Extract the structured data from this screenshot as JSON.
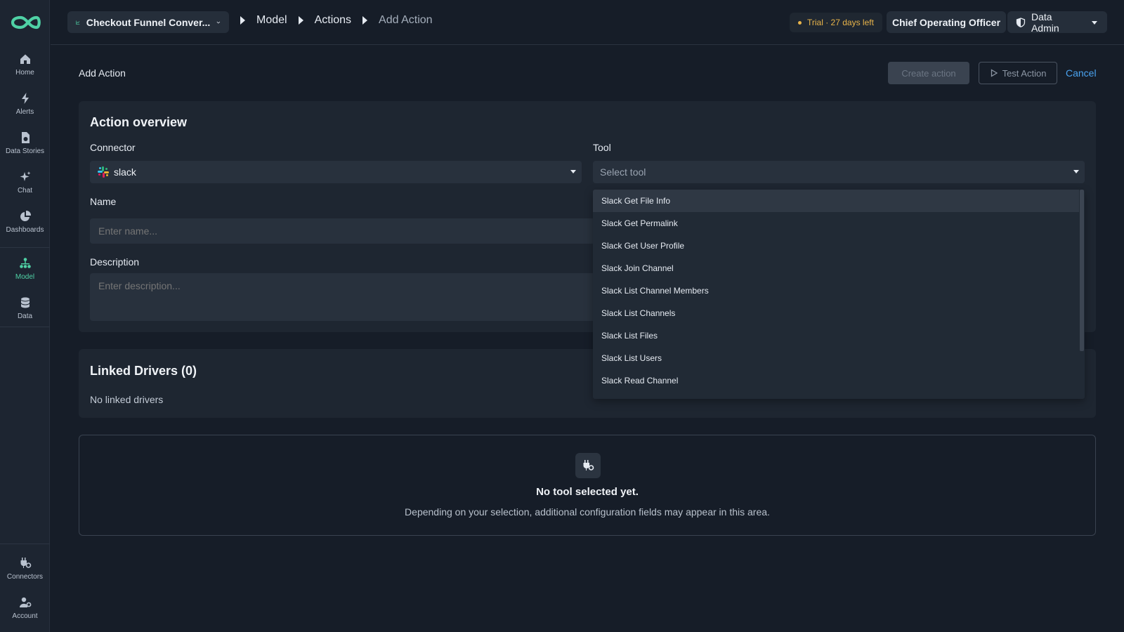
{
  "sidebar": {
    "top_items": [
      {
        "label": "Home",
        "icon": "home-icon"
      },
      {
        "label": "Alerts",
        "icon": "bolt-icon"
      },
      {
        "label": "Data Stories",
        "icon": "data-stories-icon"
      },
      {
        "label": "Chat",
        "icon": "sparkle-icon"
      },
      {
        "label": "Dashboards",
        "icon": "pie-chart-icon"
      }
    ],
    "mid_items": [
      {
        "label": "Model",
        "icon": "model-icon",
        "active": true
      },
      {
        "label": "Data",
        "icon": "database-icon"
      }
    ],
    "bottom_items": [
      {
        "label": "Connectors",
        "icon": "plug-icon"
      },
      {
        "label": "Account",
        "icon": "account-icon"
      }
    ],
    "active_color": "#4fd1a5"
  },
  "header": {
    "dashboard_select": "Checkout Funnel Conver...",
    "breadcrumb": {
      "model": "Model",
      "actions": "Actions",
      "current": "Add Action"
    },
    "trial": "Trial · 27 days left",
    "role": "Chief Operating Officer",
    "admin": "Data Admin"
  },
  "page": {
    "title": "Add Action",
    "create_button": "Create action",
    "test_button": "Test Action",
    "cancel_button": "Cancel"
  },
  "overview": {
    "title": "Action overview",
    "connector_label": "Connector",
    "connector_value": "slack",
    "tool_label": "Tool",
    "tool_placeholder": "Select tool",
    "name_label": "Name",
    "name_placeholder": "Enter name...",
    "description_label": "Description",
    "description_placeholder": "Enter description..."
  },
  "linked_drivers": {
    "title": "Linked Drivers (0)",
    "empty_text": "No linked drivers"
  },
  "empty_state": {
    "title": "No tool selected yet.",
    "description": "Depending on your selection, additional configuration fields may appear in this area."
  },
  "tool_dropdown": {
    "options": [
      "Slack Get File Info",
      "Slack Get Permalink",
      "Slack Get User Profile",
      "Slack Join Channel",
      "Slack List Channel Members",
      "Slack List Channels",
      "Slack List Files",
      "Slack List Users",
      "Slack Read Channel"
    ],
    "highlighted_index": 0
  },
  "colors": {
    "accent_teal": "#4fd1a5",
    "trial_amber": "#e8b44a",
    "link_blue": "#4aa3f0"
  }
}
